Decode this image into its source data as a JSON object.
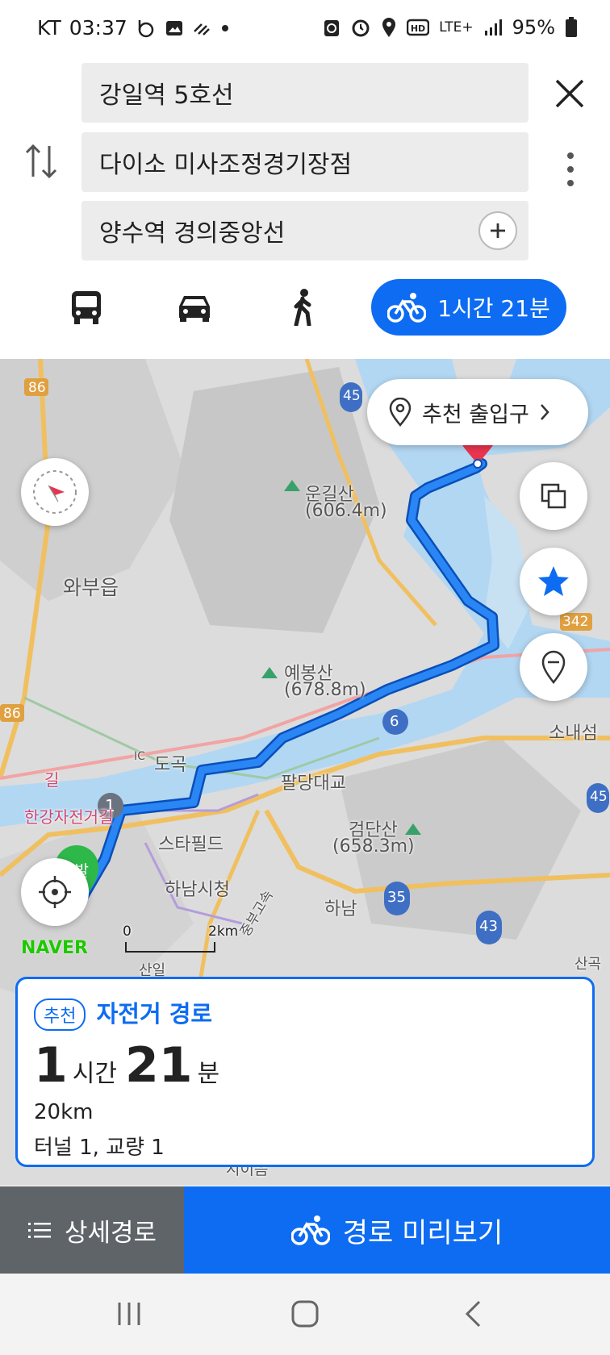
{
  "status_bar": {
    "carrier": "KT",
    "time": "03:37",
    "network": "LTE+",
    "battery": "95%"
  },
  "route_inputs": {
    "start": "강일역 5호선",
    "waypoint": "다이소 미사조정경기장점",
    "destination": "양수역 경의중앙선"
  },
  "modes": {
    "active_label": "1시간 21분"
  },
  "map": {
    "entrance_button": "추천 출입구",
    "arrival_marker": "도착",
    "departure_marker": "출발",
    "brand": "NAVER",
    "scale": {
      "zero": "0",
      "distance": "2km"
    },
    "labels": {
      "woonggilsan_name": "운길산",
      "woonggilsan_elev": "(606.4m)",
      "wabueup": "와부읍",
      "yebongsan_name": "예봉산",
      "yebongsan_elev": "(678.8m)",
      "dogok": "도곡",
      "paldang": "팔당대교",
      "hangang_bike": "한강자전거길",
      "starfield": "스타필드",
      "hanam_hall": "하남시청",
      "geomdansan_name": "검단산",
      "geomdansan_elev": "(658.3m)",
      "hanam": "하남",
      "sonaeseom": "소내섬",
      "ic": "IC",
      "sanil": "산일",
      "sangok": "산곡",
      "gil": "길",
      "jungbu": "중부고속",
      "siheung": "시이음"
    },
    "road_numbers": {
      "r86a": "86",
      "r86b": "86",
      "r45a": "45",
      "r45b": "45",
      "r342": "342",
      "r6": "6",
      "r35": "35",
      "r43": "43",
      "r1": "1"
    }
  },
  "route_card": {
    "badge": "추천",
    "title": "자전거 경로",
    "hours": "1",
    "hours_unit": "시간",
    "minutes": "21",
    "minutes_unit": "분",
    "distance": "20km",
    "facilities": "터널 1, 교량 1"
  },
  "bottom_bar": {
    "detail_label": "상세경로",
    "preview_label": "경로 미리보기"
  },
  "colors": {
    "accent": "#0d6cf2",
    "route": "#1a73e8",
    "arrival": "#e8344e",
    "departure": "#2fb84a"
  }
}
